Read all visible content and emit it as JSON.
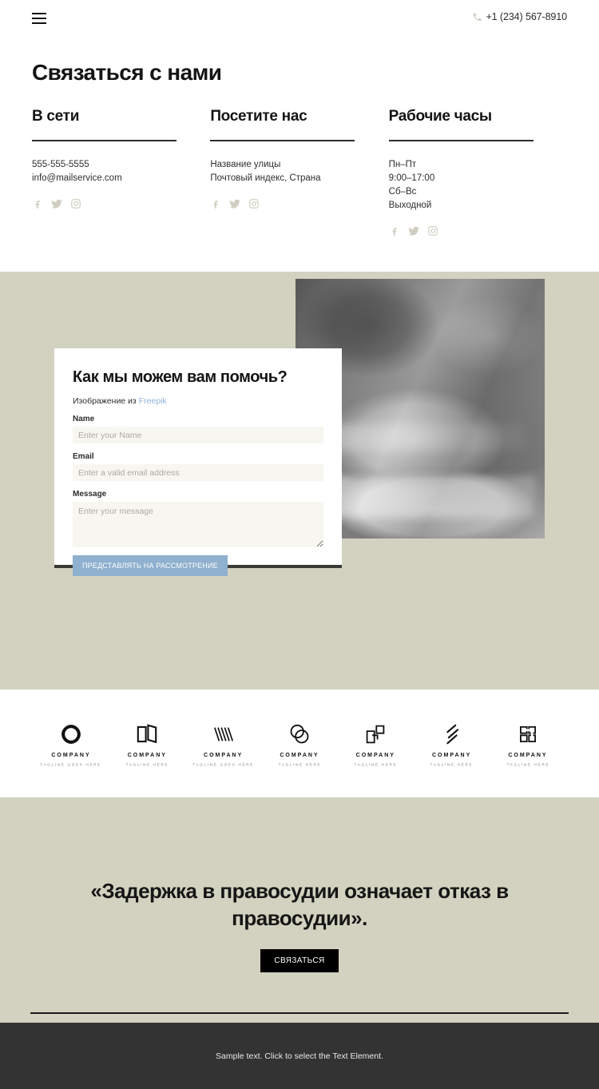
{
  "header": {
    "menu_icon": "hamburger-icon",
    "phone_icon": "phone-icon",
    "phone": "+1 (234) 567-8910"
  },
  "page_title": "Связаться с нами",
  "contacts": {
    "columns": [
      {
        "title": "В сети",
        "lines": [
          "555-555-5555",
          "info@mailservice.com"
        ],
        "socials": [
          "facebook-icon",
          "twitter-icon",
          "instagram-icon"
        ]
      },
      {
        "title": "Посетите нас",
        "lines": [
          "Название улицы",
          "Почтовый индекс, Страна"
        ],
        "socials": [
          "facebook-icon",
          "twitter-icon",
          "instagram-icon"
        ]
      },
      {
        "title": "Рабочие часы",
        "lines": [
          "Пн–Пт",
          "9:00–17:00",
          "Сб–Вс",
          "Выходной"
        ],
        "socials": [
          "facebook-icon",
          "twitter-icon",
          "instagram-icon"
        ]
      }
    ]
  },
  "form": {
    "title": "Как мы можем вам помочь?",
    "credit_prefix": "Изображение из ",
    "credit_link": "Freepik",
    "fields": {
      "name_label": "Name",
      "name_placeholder": "Enter your Name",
      "name_value": "",
      "email_label": "Email",
      "email_placeholder": "Enter a valid email address",
      "email_value": "",
      "message_label": "Message",
      "message_placeholder": "Enter your message",
      "message_value": ""
    },
    "submit_label": "ПРЕДСТАВЛЯТЬ НА РАССМОТРЕНИЕ",
    "submit_color": "#8fb0ce"
  },
  "hero": {
    "background_color": "#d2d2c0",
    "photo_alt": "handshake-photo"
  },
  "logos": [
    {
      "mark": "logo-mark-circle",
      "name": "COMPANY",
      "tagline": "TAGLINE GOES HERE"
    },
    {
      "mark": "logo-mark-book",
      "name": "COMPANY",
      "tagline": "TAGLINE HERE"
    },
    {
      "mark": "logo-mark-w",
      "name": "COMPANY",
      "tagline": "TAGLINE GOES HERE"
    },
    {
      "mark": "logo-mark-rings",
      "name": "COMPANY",
      "tagline": "TAGLINE HERE"
    },
    {
      "mark": "logo-mark-squares",
      "name": "COMPANY",
      "tagline": "TAGLINE HERE"
    },
    {
      "mark": "logo-mark-slashes",
      "name": "COMPANY",
      "tagline": "TAGLINE HERE"
    },
    {
      "mark": "logo-mark-monogram",
      "name": "COMPANY",
      "tagline": "TAGLINE HERE"
    }
  ],
  "quote": {
    "text": "«Задержка в правосудии означает отказ в правосудии».",
    "button_label": "СВЯЗАТЬСЯ",
    "button_color": "#000000",
    "background_color": "#d2d2c0"
  },
  "footer": {
    "text": "Sample text. Click to select the Text Element.",
    "background_color": "#333333"
  }
}
